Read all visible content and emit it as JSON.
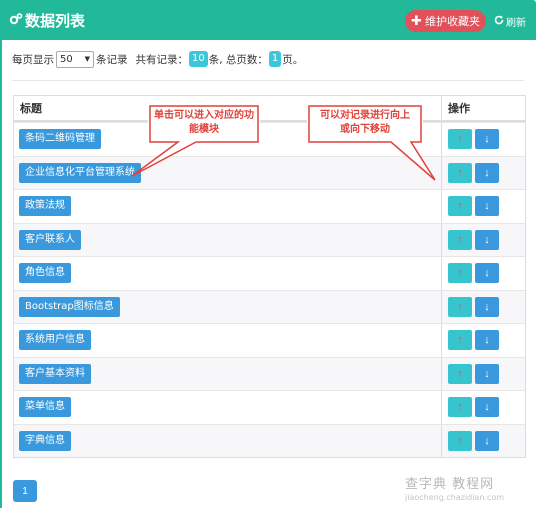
{
  "header": {
    "title": "数据列表",
    "fav_button": "维护收藏夹",
    "refresh_button": "刷新",
    "color": "#22b99b"
  },
  "pager": {
    "prefix": "每页显示",
    "page_size": "50",
    "suffix": "条记录",
    "total_prefix": "共有记录：",
    "total_records": "10",
    "total_unit": "条, 总页数：",
    "total_pages": "1",
    "pages_unit": "页。"
  },
  "table": {
    "col_title": "标题",
    "col_action": "操作",
    "rows": [
      {
        "label": "条码二维码管理"
      },
      {
        "label": "企业信息化平台管理系统"
      },
      {
        "label": "政策法规"
      },
      {
        "label": "客户联系人"
      },
      {
        "label": "角色信息"
      },
      {
        "label": "Bootstrap图标信息"
      },
      {
        "label": "系统用户信息"
      },
      {
        "label": "客户基本资料"
      },
      {
        "label": "菜单信息"
      },
      {
        "label": "字典信息"
      }
    ]
  },
  "callouts": {
    "left": "单击可以进入对应的功能模块",
    "right": "可以对记录进行向上或向下移动"
  },
  "pagination": {
    "current": "1"
  },
  "watermark": {
    "line1": "查字典 教程网",
    "line2": "jiaocheng.chazidian.com"
  },
  "icons": {
    "title": "cogs-icon",
    "fav": "plus-icon",
    "refresh": "refresh-icon",
    "up": "arrow-up-icon",
    "down": "arrow-down-icon"
  }
}
